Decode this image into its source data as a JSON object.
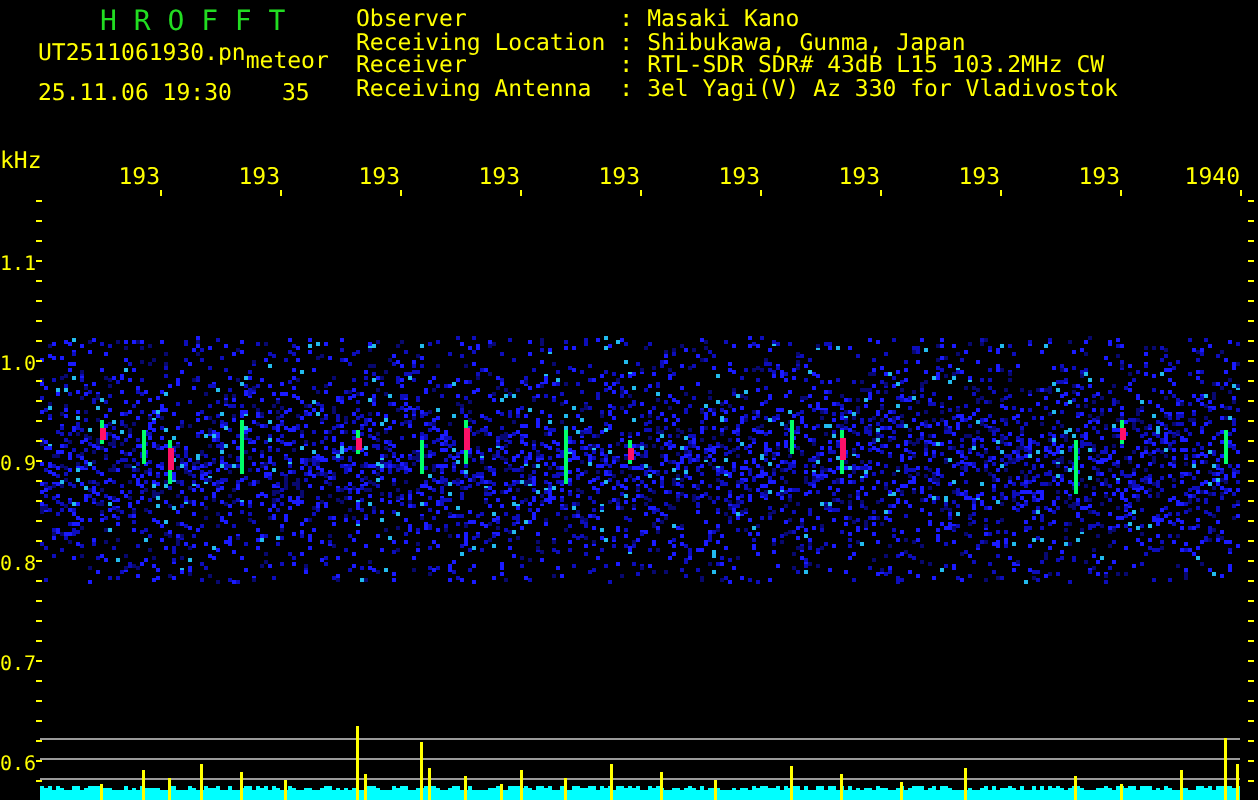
{
  "app": {
    "title": "H R O F F T",
    "file_name": "UT2511061930.pn",
    "mode": "meteor",
    "date_time": "25.11.06 19:30",
    "count": "35"
  },
  "station_info": [
    {
      "label": "Observer",
      "separator": ":",
      "value": "Masaki Kano"
    },
    {
      "label": "Receiving Location",
      "separator": ":",
      "value": "Shibukawa, Gunma, Japan"
    },
    {
      "label": "Receiver",
      "separator": ":",
      "value": "RTL-SDR SDR# 43dB L15 103.2MHz CW"
    },
    {
      "label": "Receiving Antenna",
      "separator": ":",
      "value": "3el Yagi(V) Az 330 for Vladivostok"
    }
  ],
  "time_axis": {
    "labels": [
      "193",
      "193",
      "193",
      "193",
      "193",
      "193",
      "193",
      "193",
      "193",
      "1940"
    ]
  },
  "frequency_axis": {
    "unit": "kHz",
    "labels": [
      "1.1",
      "1.0",
      "0.9",
      "0.8",
      "0.7",
      "0.6"
    ]
  }
}
